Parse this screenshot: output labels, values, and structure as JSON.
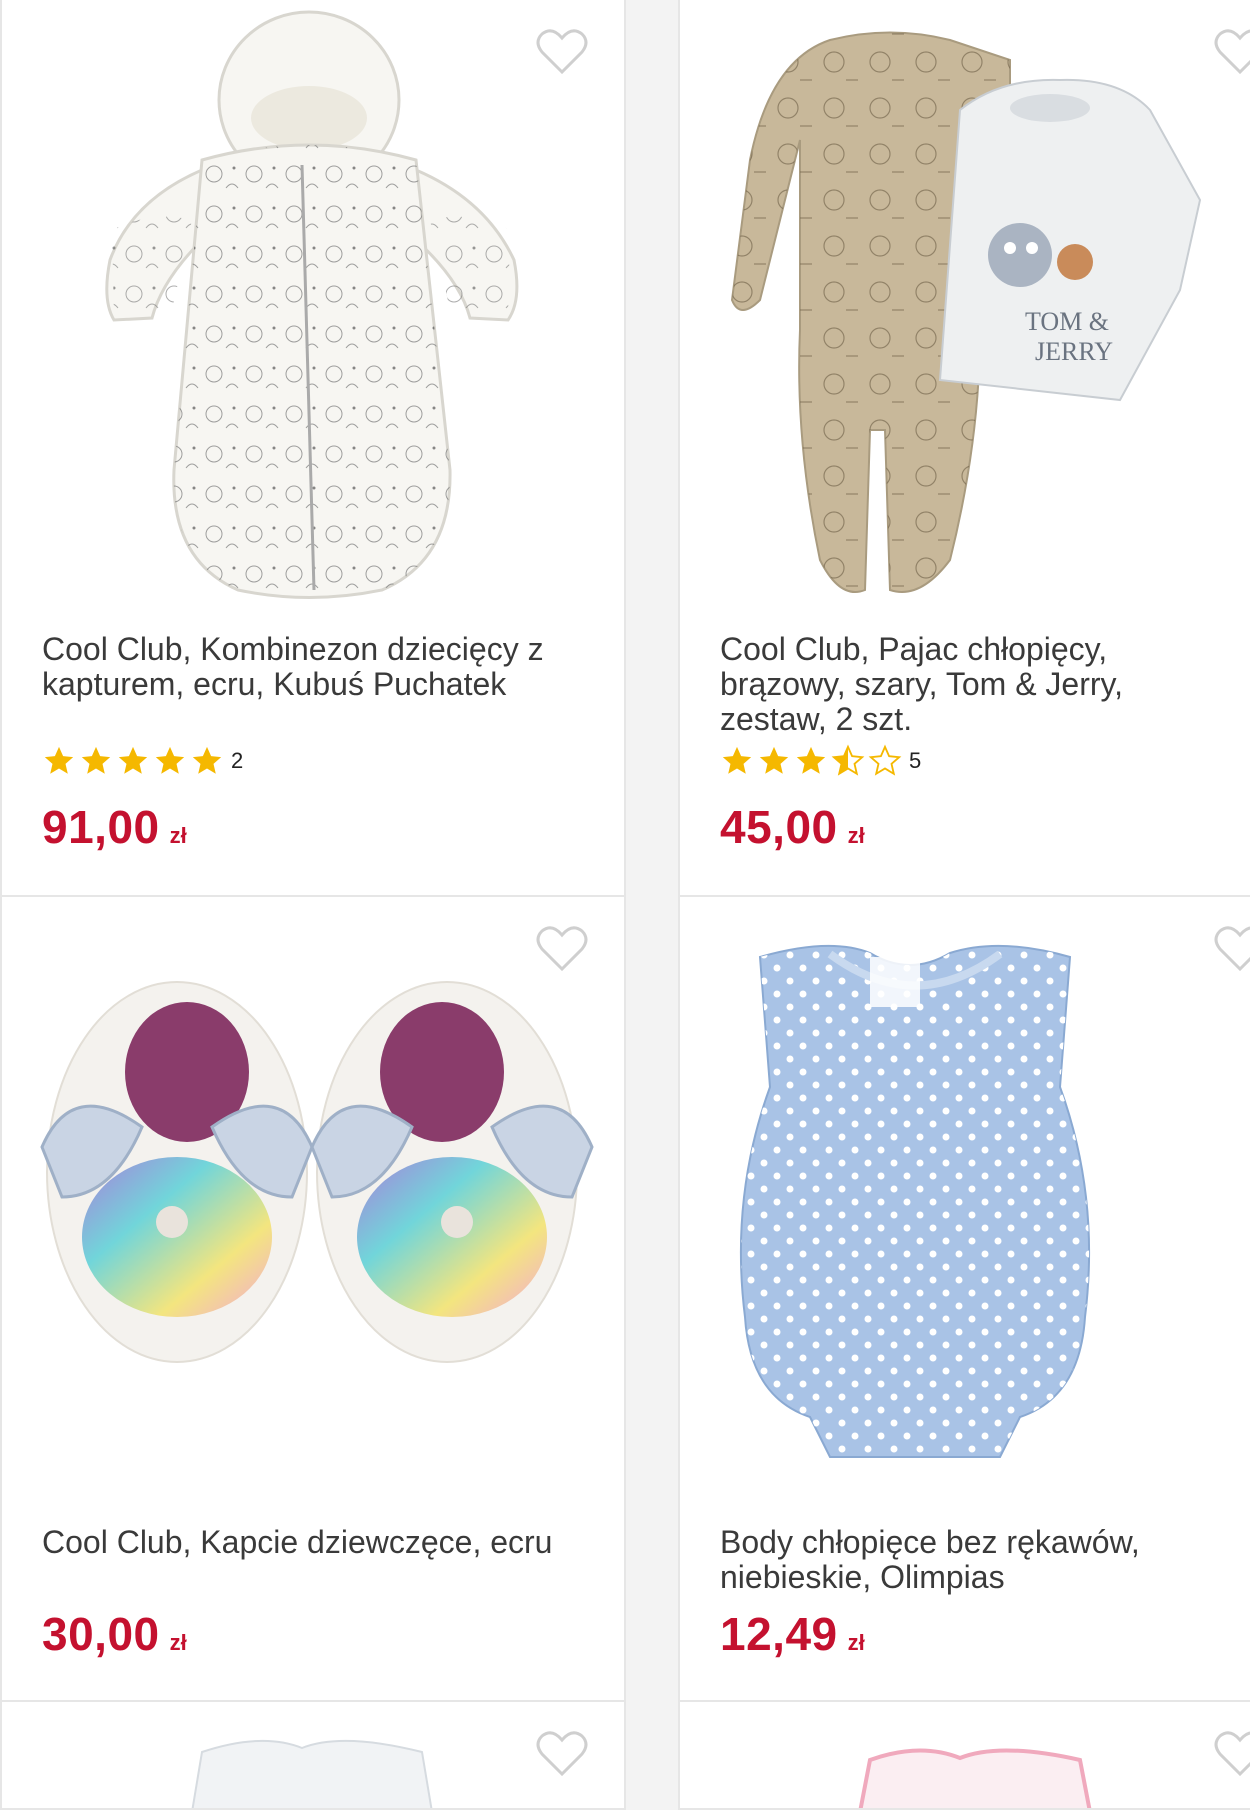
{
  "products": [
    {
      "title": "Cool Club, Kombinezon dziecięcy z kapturem, ecru, Kubuś Puchatek",
      "rating": 5,
      "rating_count": "2",
      "price": "91,00",
      "currency": "zł"
    },
    {
      "title": "Cool Club, Pajac chłopięcy, brązowy, szary, Tom & Jerry, zestaw, 2 szt.",
      "rating": 3.5,
      "rating_count": "5",
      "price": "45,00",
      "currency": "zł"
    },
    {
      "title": "Cool Club, Kapcie dziewczęce, ecru",
      "price": "30,00",
      "currency": "zł"
    },
    {
      "title": "Body chłopięce bez rękawów, niebieskie, Olimpias",
      "price": "12,49",
      "currency": "zł"
    }
  ],
  "colors": {
    "price": "#c4112f",
    "star": "#f5b800",
    "heart_outline": "#cfcfcf",
    "card_border": "#e6e6e6"
  },
  "icons": {
    "favorite": "heart-outline-icon",
    "rating_full": "star-filled-icon",
    "rating_half": "star-half-icon",
    "rating_empty": "star-outline-icon"
  }
}
